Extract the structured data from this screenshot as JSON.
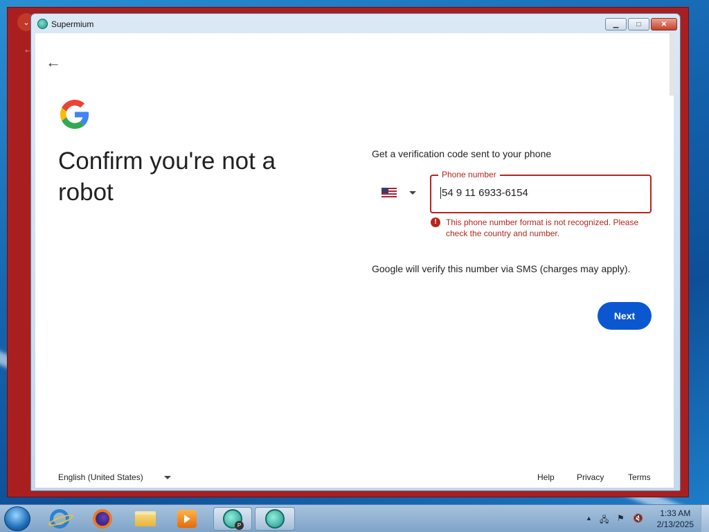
{
  "window": {
    "app_title": "Supermium",
    "minimize_symbol": "▁",
    "maximize_symbol": "□",
    "close_symbol": "✕"
  },
  "page": {
    "back_symbol": "←",
    "heading": "Confirm you're not a robot",
    "subtitle": "Get a verification code sent to your phone",
    "country_flag": "us-flag-icon",
    "phone_label": "Phone number",
    "phone_value": "54 9 11 6933-6154",
    "error_symbol": "!",
    "error_message": "This phone number format is not recognized. Please check the country and number.",
    "sms_note": "Google will verify this number via SMS (charges may apply).",
    "next_label": "Next"
  },
  "footer": {
    "language": "English (United States)",
    "links": [
      "Help",
      "Privacy",
      "Terms"
    ]
  },
  "taskbar": {
    "apps": [
      "internet-explorer-icon",
      "firefox-icon",
      "file-explorer-icon",
      "media-player-icon",
      "supermium-icon",
      "supermium-icon"
    ],
    "badge": "P",
    "time": "1:33 AM",
    "date": "2/13/2025"
  },
  "colors": {
    "error": "#b3261e",
    "primary_button": "#0b57d0",
    "background_window": "#a91f1f"
  }
}
